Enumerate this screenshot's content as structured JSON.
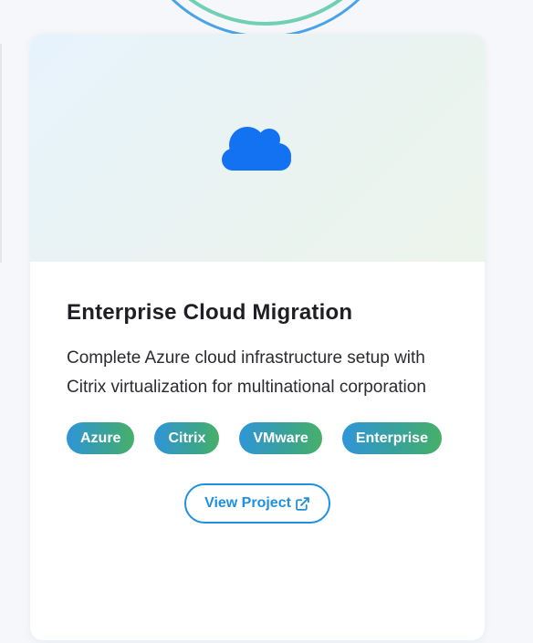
{
  "card": {
    "media_icon": "cloud-icon",
    "title": "Enterprise Cloud Migration",
    "description": "Complete Azure cloud infrastructure setup with Citrix virtualization for multinational corporation",
    "tags": [
      "Azure",
      "Citrix",
      "VMware",
      "Enterprise"
    ],
    "button": {
      "label": "View Project",
      "icon": "external-link-icon"
    }
  },
  "colors": {
    "accent_blue": "#1f8fe0",
    "cloud_blue": "#1372f2",
    "tag_gradient_start": "#2f95d8",
    "tag_gradient_end": "#47b068",
    "ring_blue": "#4aa3e8",
    "ring_green": "#72d0b2"
  }
}
